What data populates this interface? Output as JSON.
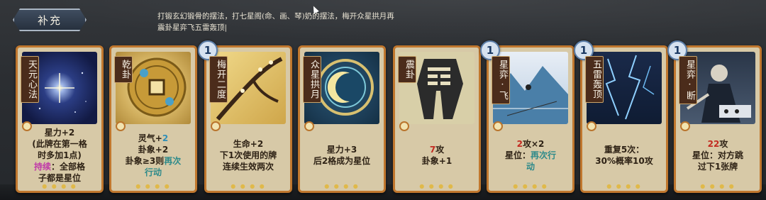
{
  "header": {
    "tab_label": "补充",
    "description_line1": "打锻玄幻锻骨的摆法，打七星阁(命、画、琴)奶的摆法，梅开众星拱月再",
    "description_line2": "震卦星弈飞五雷轰顶|"
  },
  "cards": [
    {
      "name": "天元心法",
      "cost": "",
      "lines": [
        "星力+2",
        "(此牌在第一格",
        "时多加1点)"
      ],
      "extra_label": "持续",
      "extra_text": "：全部格",
      "extra_line2": "子都是星位"
    },
    {
      "name": "乾卦",
      "cost": "",
      "line1_a": "灵气+",
      "line1_b": "2",
      "line2": "卦象+2",
      "line3_a": "卦象≥3则",
      "line3_b": "再次",
      "line4": "行动"
    },
    {
      "name": "梅开二度",
      "cost": "1",
      "lines": [
        "生命+2",
        "下1次使用的牌",
        "连续生效两次"
      ]
    },
    {
      "name": "众星拱月",
      "cost": "",
      "lines": [
        "星力+3",
        "后2格成为星位"
      ]
    },
    {
      "name": "震卦",
      "cost": "",
      "line1_a": "7",
      "line1_b": "攻",
      "line2": "卦象+1"
    },
    {
      "name": "星弈·飞",
      "cost": "1",
      "line1_a": "2",
      "line1_b": "攻×2",
      "line2_a": "星位：",
      "line2_b": "再次行",
      "line3": "动"
    },
    {
      "name": "五雷轰顶",
      "cost": "1",
      "lines": [
        "重复5次：",
        "30%概率10攻"
      ]
    },
    {
      "name": "星弈·断",
      "cost": "1",
      "line1_a": "22",
      "line1_b": "攻",
      "line2": "星位：对方跳",
      "line3": "过下1张牌"
    }
  ],
  "colors": {
    "card_border": "#c0772e",
    "card_face": "#d7c9a7",
    "highlight_blue": "#2f8fb8",
    "highlight_red": "#c22a20"
  }
}
